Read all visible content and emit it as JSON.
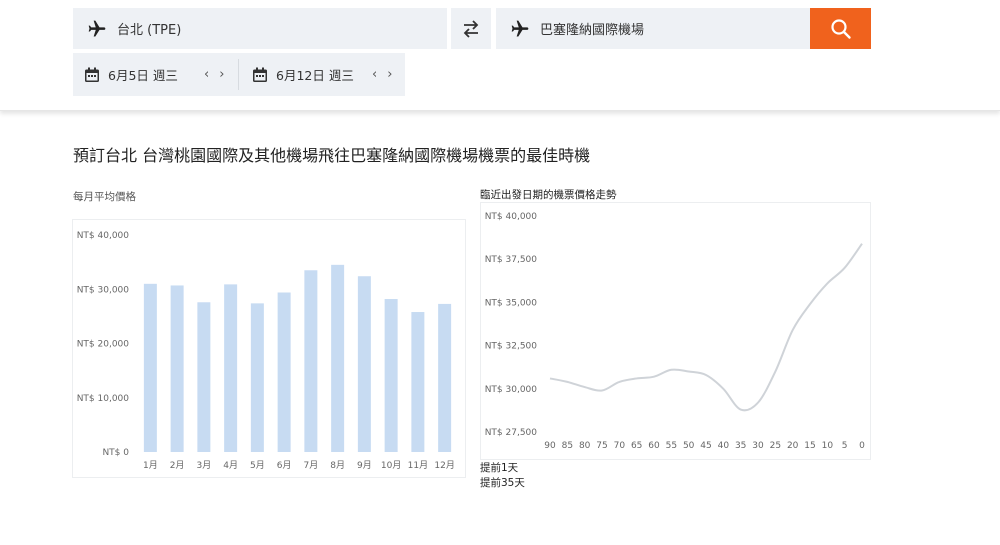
{
  "search": {
    "origin": "台北 (TPE)",
    "destination": "巴塞隆納國際機場",
    "depart_date": "6月5日 週三",
    "return_date": "6月12日 週三",
    "prev_glyph": "‹",
    "next_glyph": "›"
  },
  "headline": "預訂台北 台灣桃園國際及其他機場飛往巴塞隆納國際機場機票的最佳時機",
  "chart_data": [
    {
      "type": "bar",
      "title": "每月平均價格",
      "categories": [
        "1月",
        "2月",
        "3月",
        "4月",
        "5月",
        "6月",
        "7月",
        "8月",
        "9月",
        "10月",
        "11月",
        "12月"
      ],
      "values": [
        31000,
        30700,
        27600,
        30900,
        27400,
        29400,
        33500,
        34500,
        32400,
        28200,
        25800,
        27300
      ],
      "ylim": [
        0,
        40000
      ],
      "yticks": [
        0,
        10000,
        20000,
        30000,
        40000
      ],
      "ytick_labels": [
        "NT$ 0",
        "NT$ 10,000",
        "NT$ 20,000",
        "NT$ 30,000",
        "NT$ 40,000"
      ],
      "grid": false,
      "color": "#c7dbf2"
    },
    {
      "type": "line",
      "title": "臨近出發日期的機票價格走勢",
      "x": [
        90,
        85,
        80,
        75,
        70,
        65,
        60,
        55,
        50,
        45,
        40,
        35,
        30,
        25,
        20,
        15,
        10,
        5,
        0
      ],
      "xtick_labels": [
        "90",
        "85",
        "80",
        "75",
        "70",
        "65",
        "60",
        "55",
        "50",
        "45",
        "40",
        "35",
        "30",
        "25",
        "20",
        "15",
        "10",
        "5",
        "0"
      ],
      "values": [
        30600,
        30400,
        30100,
        29900,
        30400,
        30600,
        30700,
        31100,
        31000,
        30800,
        30000,
        28800,
        29200,
        31000,
        33400,
        34900,
        36100,
        37000,
        38400
      ],
      "ylim": [
        27500,
        40000
      ],
      "yticks": [
        27500,
        30000,
        32500,
        35000,
        37500,
        40000
      ],
      "ytick_labels": [
        "NT$ 27,500",
        "NT$ 30,000",
        "NT$ 32,500",
        "NT$ 35,000",
        "NT$ 37,500",
        "NT$ 40,000"
      ],
      "x_reversed": true,
      "grid": false,
      "color": "#cfd3d8"
    }
  ],
  "notes": {
    "line1": "提前1天",
    "line2": "提前35天"
  },
  "colors": {
    "accent": "#f0621d",
    "field_bg": "#eef1f5"
  },
  "icons": {
    "origin": "plane-icon",
    "destination": "plane-icon",
    "swap": "swap-arrows-icon",
    "search": "search-icon",
    "calendar": "calendar-icon"
  }
}
